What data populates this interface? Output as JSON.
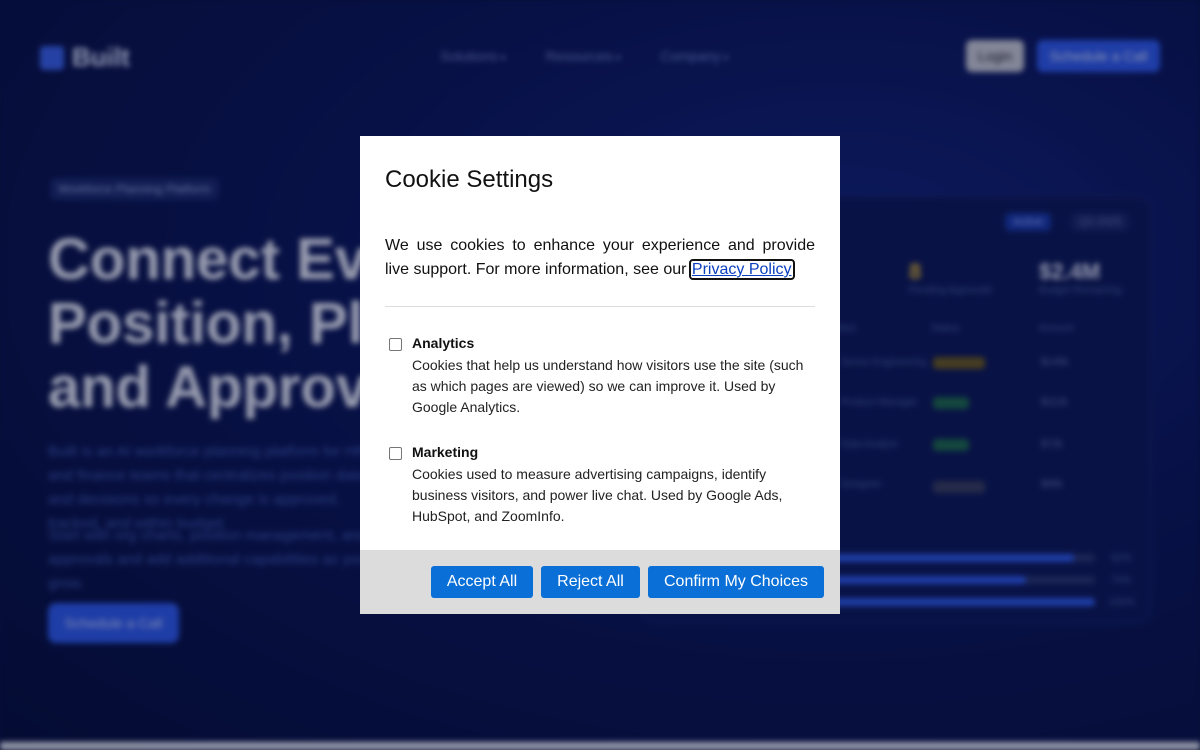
{
  "background": {
    "logo_text": "Built",
    "nav_links": [
      {
        "label": "Solutions"
      },
      {
        "label": "Resources"
      },
      {
        "label": "Company"
      }
    ],
    "nav_chevron": "▾",
    "login_label": "Login",
    "schedule_top_label": "Schedule a Call",
    "badge": "Workforce Planning Platform",
    "hero_lines": [
      "Connect Every",
      "Position, Plan,",
      "and Approval"
    ],
    "hero_paragraph_1": "Built is an AI workforce planning platform for HR and finance teams that centralizes position data and decisions so every change is approved, tracked, and within budget.",
    "hero_paragraph_2": "Start with org charts, position management, and approvals and add additional capabilities as you grow.",
    "schedule_hero_label": "Schedule a Call",
    "dashboard": {
      "tag_active": "Active",
      "tag_other": "Q3 2025",
      "kpis": [
        {
          "value": "8",
          "label": "Pending Approvals"
        },
        {
          "value": "$2.4M",
          "label": "Budget Remaining"
        }
      ],
      "columns": [
        "Position",
        "Status",
        "Amount"
      ],
      "rows": [
        {
          "name": "Senior Engineering",
          "status": "Pending",
          "amount": "$145k"
        },
        {
          "name": "Product Manager",
          "status": "Active",
          "amount": "$112k"
        },
        {
          "name": "Data Analyst",
          "status": "Active",
          "amount": "$72k"
        },
        {
          "name": "Designer",
          "status": "Planned",
          "amount": "$95k"
        }
      ],
      "bars": [
        {
          "fill": 0.92,
          "label": "92%"
        },
        {
          "fill": 0.74,
          "label": "74%"
        },
        {
          "fill": 1.0,
          "label": "100%"
        }
      ]
    }
  },
  "cookie_modal": {
    "title": "Cookie Settings",
    "intro": "We use cookies to enhance your experience and provide live support. For more information, see our",
    "privacy_link": "Privacy Policy",
    "options": [
      {
        "title": "Analytics",
        "description": "Cookies that help us understand how visitors use the site (such as which pages are viewed) so we can improve it. Used by Google Analytics.",
        "checked": false
      },
      {
        "title": "Marketing",
        "description": "Cookies used to measure advertising campaigns, identify business visitors, and power live chat. Used by Google Ads, HubSpot, and ZoomInfo.",
        "checked": false
      }
    ],
    "buttons": {
      "accept_all": "Accept All",
      "reject_all": "Reject All",
      "confirm": "Confirm My Choices"
    },
    "button_color": "#0a6fd6",
    "footer_color": "#dcdcdc"
  }
}
